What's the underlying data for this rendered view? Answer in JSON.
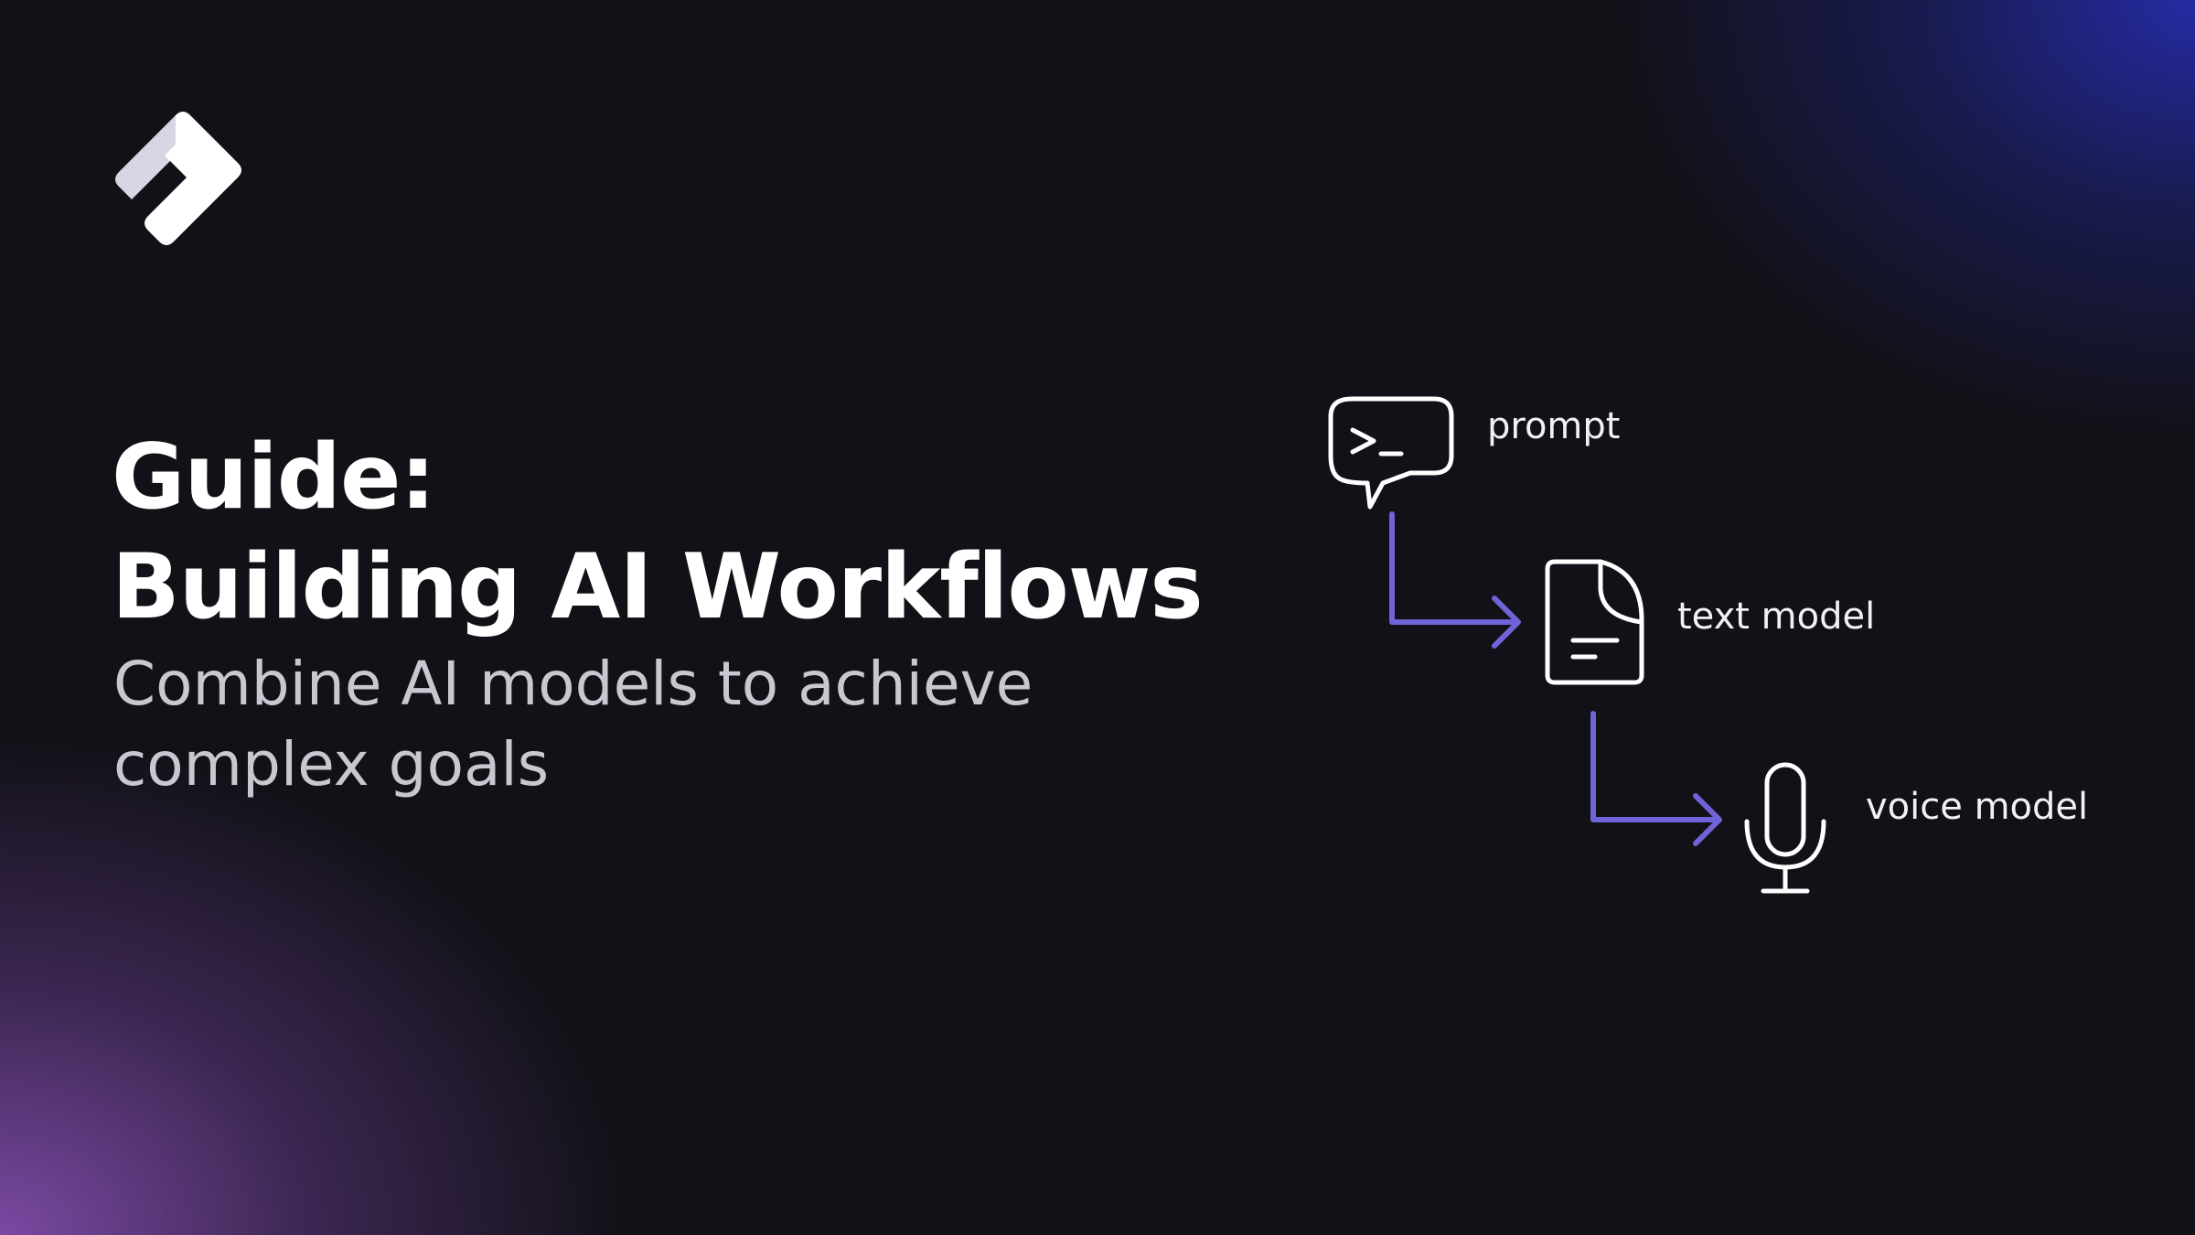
{
  "headline": {
    "line1": "Guide:",
    "line2": "Building AI Workflows"
  },
  "subtitle": "Combine AI models to achieve complex goals",
  "workflow": {
    "steps": [
      {
        "label": "prompt",
        "icon": "terminal-chat-icon"
      },
      {
        "label": "text model",
        "icon": "document-icon"
      },
      {
        "label": "voice model",
        "icon": "microphone-icon"
      }
    ],
    "arrow_color": "#6f63d8"
  },
  "colors": {
    "background": "#121117",
    "glow_top_right": "#262caa",
    "glow_bottom_left": "#804caa",
    "headline": "#ffffff",
    "subtitle": "#c9c8d0"
  }
}
